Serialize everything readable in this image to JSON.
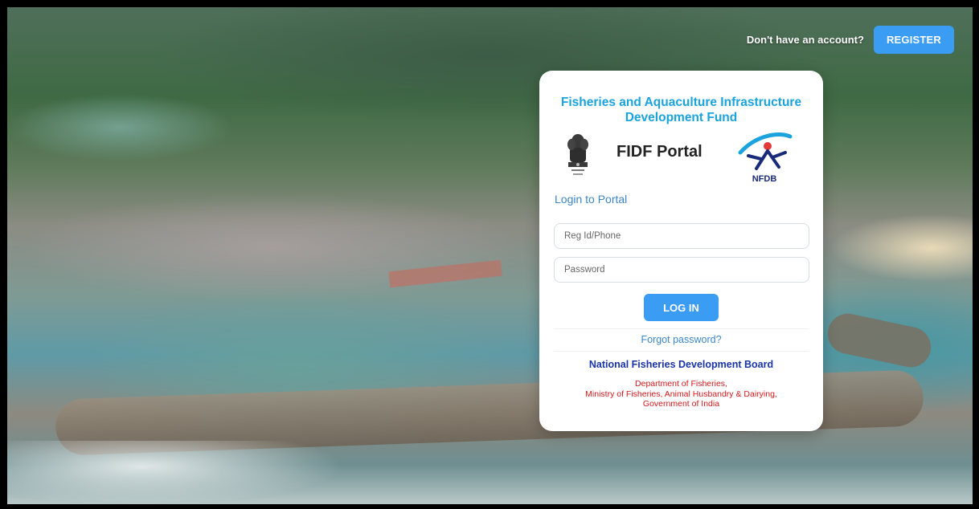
{
  "header": {
    "account_prompt": "Don't have an account?",
    "register_label": "REGISTER"
  },
  "card": {
    "title": "Fisheries and Aquaculture Infrastructure Development Fund",
    "portal_name": "FIDF Portal",
    "nfdb_logo_text": "NFDB",
    "login_heading": "Login to Portal",
    "reg_placeholder": "Reg Id/Phone",
    "password_placeholder": "Password",
    "login_label": "LOG IN",
    "forgot_label": "Forgot password?",
    "board_name": "National Fisheries Development Board",
    "ministry_lines": [
      "Department of Fisheries,",
      "Ministry of Fisheries, Animal Husbandry & Dairying,",
      "Government of India"
    ]
  },
  "icons": {
    "emblem": "state-emblem-icon",
    "nfdb": "nfdb-logo-icon"
  },
  "colors": {
    "accent": "#3a9cf2",
    "title": "#1aa3dd",
    "board": "#1a33a6",
    "ministry": "#d5191c"
  }
}
